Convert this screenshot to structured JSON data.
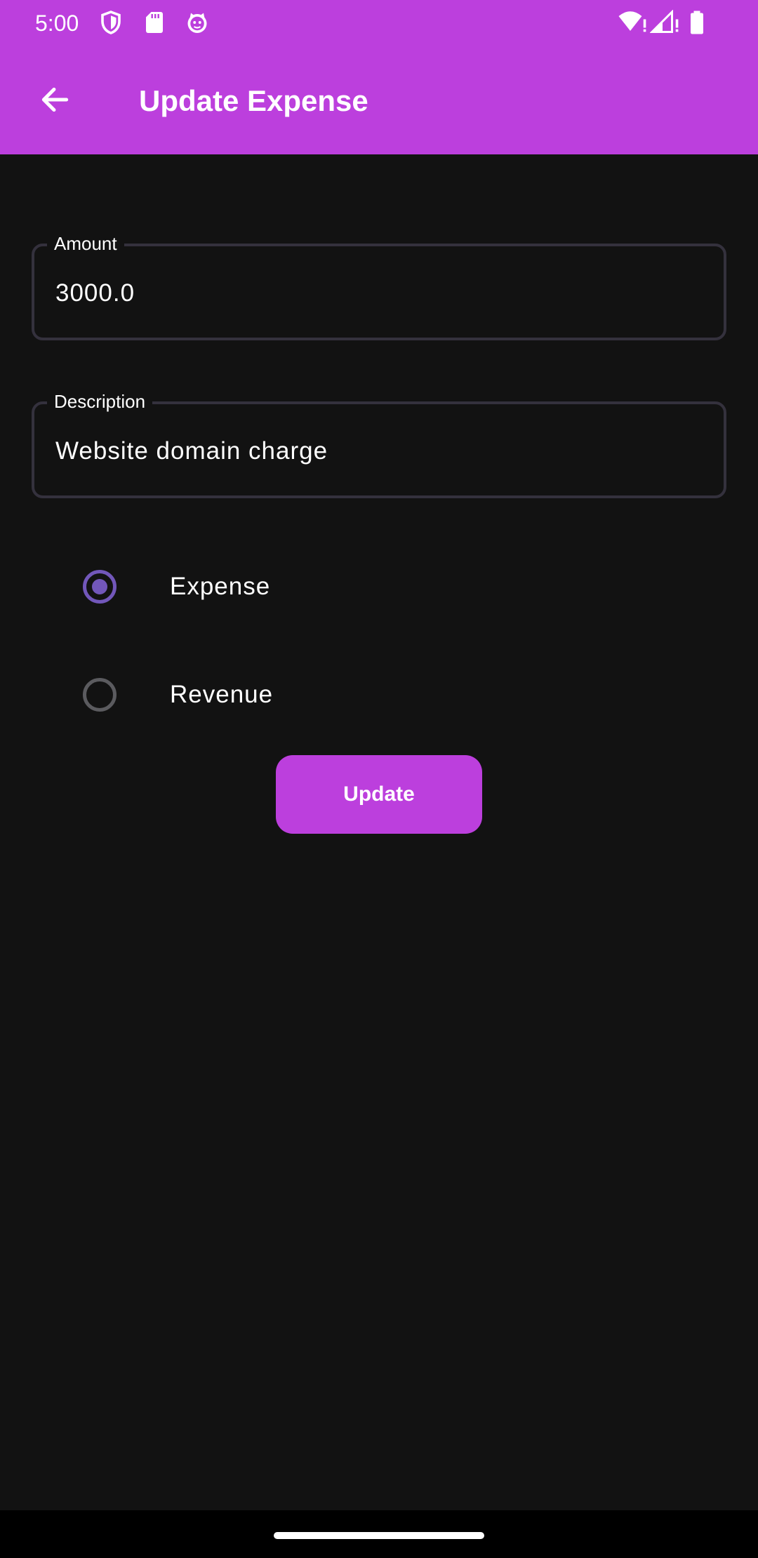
{
  "status_bar": {
    "time": "5:00",
    "left_icons": [
      "shield-icon",
      "sd-card-icon",
      "cat-face-icon"
    ],
    "right_icons": [
      "wifi-alert-icon",
      "signal-alert-icon",
      "battery-icon"
    ]
  },
  "toolbar": {
    "title": "Update Expense",
    "back_icon": "arrow-back-icon"
  },
  "form": {
    "amount": {
      "label": "Amount",
      "value": "3000.0"
    },
    "description": {
      "label": "Description",
      "value": "Website domain charge"
    },
    "type_options": [
      {
        "label": "Expense",
        "selected": true
      },
      {
        "label": "Revenue",
        "selected": false
      }
    ],
    "submit_label": "Update"
  },
  "colors": {
    "primary": "#BC3FDD",
    "radio_selected": "#7257BA",
    "background": "#121212"
  }
}
